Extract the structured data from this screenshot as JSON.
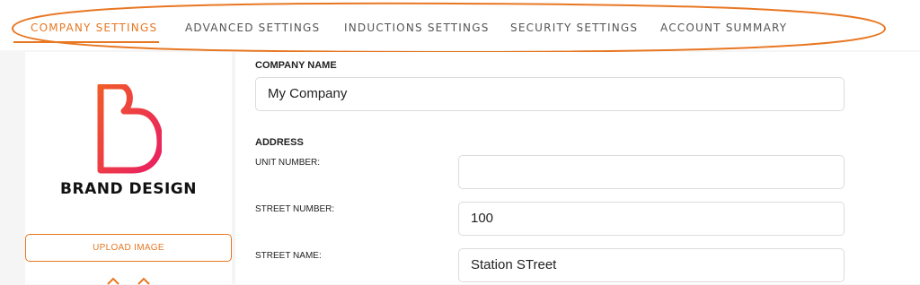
{
  "tabs": [
    {
      "label": "COMPANY SETTINGS",
      "active": true
    },
    {
      "label": "ADVANCED SETTINGS",
      "active": false
    },
    {
      "label": "INDUCTIONS SETTINGS",
      "active": false
    },
    {
      "label": "SECURITY SETTINGS",
      "active": false
    },
    {
      "label": "ACCOUNT SUMMARY",
      "active": false
    }
  ],
  "logo": {
    "brand_text": "BRAND DESIGN",
    "gradient_from": "#f15a29",
    "gradient_to": "#e91e63"
  },
  "upload_button_label": "UPLOAD IMAGE",
  "form": {
    "company_name_label": "COMPANY NAME",
    "company_name_value": "My Company",
    "address_label": "ADDRESS",
    "unit_number_label": "UNIT NUMBER:",
    "unit_number_value": "",
    "street_number_label": "STREET NUMBER:",
    "street_number_value": "100",
    "street_name_label": "STREET NAME:",
    "street_name_value": "Station STreet"
  },
  "colors": {
    "accent": "#e87722"
  }
}
